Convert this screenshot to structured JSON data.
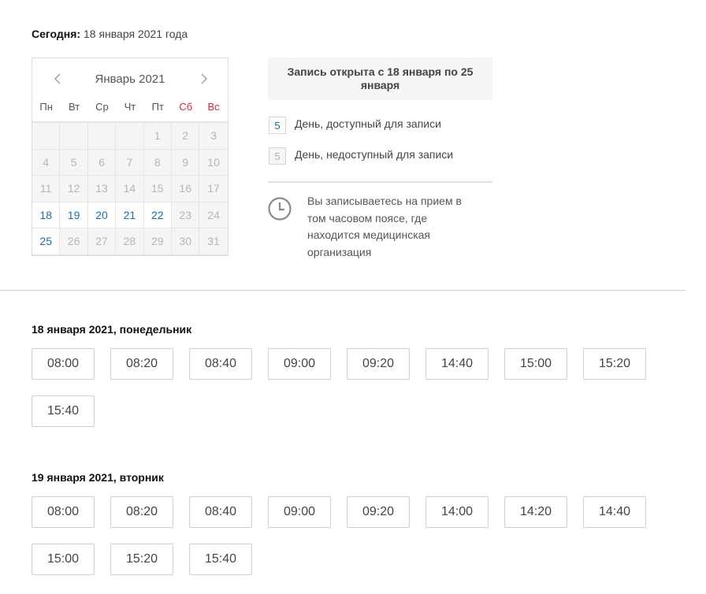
{
  "today": {
    "label": "Сегодня:",
    "value": "18 января 2021 года"
  },
  "calendar": {
    "title": "Январь 2021",
    "prev_icon": "chevron-left-icon",
    "next_icon": "chevron-right-icon",
    "weekdays": [
      {
        "label": "Пн",
        "weekend": false
      },
      {
        "label": "Вт",
        "weekend": false
      },
      {
        "label": "Ср",
        "weekend": false
      },
      {
        "label": "Чт",
        "weekend": false
      },
      {
        "label": "Пт",
        "weekend": false
      },
      {
        "label": "Сб",
        "weekend": true
      },
      {
        "label": "Вс",
        "weekend": true
      }
    ],
    "weeks": [
      [
        {
          "d": "",
          "a": false
        },
        {
          "d": "",
          "a": false
        },
        {
          "d": "",
          "a": false
        },
        {
          "d": "",
          "a": false
        },
        {
          "d": "1",
          "a": false
        },
        {
          "d": "2",
          "a": false
        },
        {
          "d": "3",
          "a": false
        }
      ],
      [
        {
          "d": "4",
          "a": false
        },
        {
          "d": "5",
          "a": false
        },
        {
          "d": "6",
          "a": false
        },
        {
          "d": "7",
          "a": false
        },
        {
          "d": "8",
          "a": false
        },
        {
          "d": "9",
          "a": false
        },
        {
          "d": "10",
          "a": false
        }
      ],
      [
        {
          "d": "11",
          "a": false
        },
        {
          "d": "12",
          "a": false
        },
        {
          "d": "13",
          "a": false
        },
        {
          "d": "14",
          "a": false
        },
        {
          "d": "15",
          "a": false
        },
        {
          "d": "16",
          "a": false
        },
        {
          "d": "17",
          "a": false
        }
      ],
      [
        {
          "d": "18",
          "a": true
        },
        {
          "d": "19",
          "a": true
        },
        {
          "d": "20",
          "a": true
        },
        {
          "d": "21",
          "a": true
        },
        {
          "d": "22",
          "a": true
        },
        {
          "d": "23",
          "a": false
        },
        {
          "d": "24",
          "a": false
        }
      ],
      [
        {
          "d": "25",
          "a": true
        },
        {
          "d": "26",
          "a": false
        },
        {
          "d": "27",
          "a": false
        },
        {
          "d": "28",
          "a": false
        },
        {
          "d": "29",
          "a": false
        },
        {
          "d": "30",
          "a": false
        },
        {
          "d": "31",
          "a": false
        }
      ]
    ],
    "colors": {
      "available": "#1b6ea8",
      "unavailable": "#b6b6b6",
      "weekend": "#d0293b"
    }
  },
  "info": {
    "open_period": "Запись открыта с 18 января по 25 января",
    "legend_available": {
      "sample": "5",
      "text": "День, доступный для записи"
    },
    "legend_unavailable": {
      "sample": "5",
      "text": "День, недоступный для записи"
    },
    "timezone_icon": "clock-icon",
    "timezone_note": "Вы записываетесь на прием в том часовом поясе, где находится медицинская организация"
  },
  "schedule": [
    {
      "title": "18 января 2021, понедельник",
      "slots": [
        "08:00",
        "08:20",
        "08:40",
        "09:00",
        "09:20",
        "14:40",
        "15:00",
        "15:20",
        "15:40"
      ]
    },
    {
      "title": "19 января 2021, вторник",
      "slots": [
        "08:00",
        "08:20",
        "08:40",
        "09:00",
        "09:20",
        "14:00",
        "14:20",
        "14:40",
        "15:00",
        "15:20",
        "15:40"
      ]
    }
  ]
}
